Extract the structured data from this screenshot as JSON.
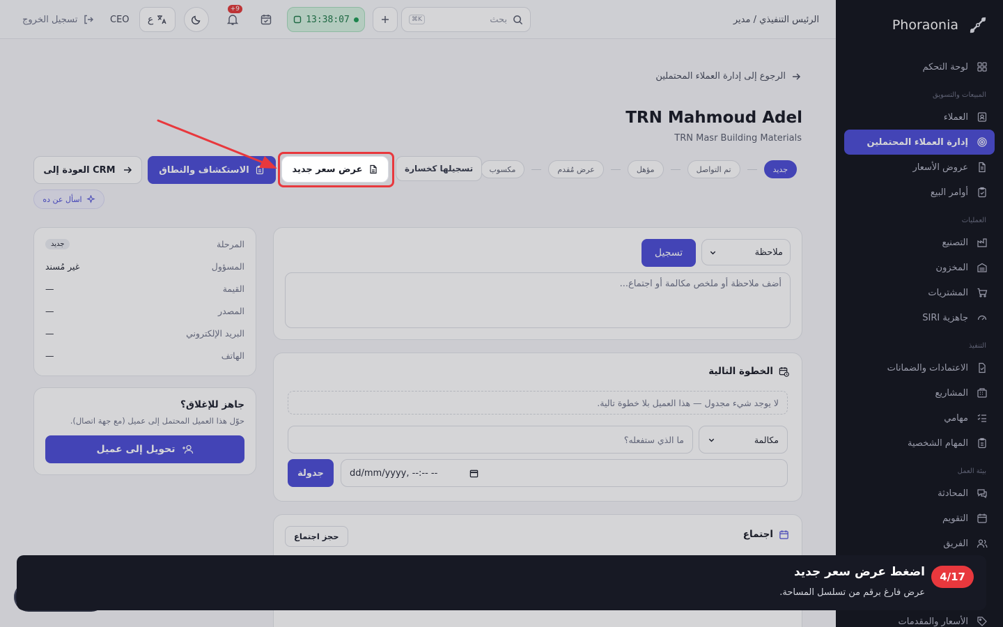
{
  "sidebar": {
    "brand": "Phoraonia",
    "items": [
      {
        "type": "item",
        "label": "لوحة التحكم",
        "icon": "grid-icon"
      },
      {
        "type": "section",
        "label": "المبيعات والتسويق"
      },
      {
        "type": "item",
        "label": "العملاء",
        "icon": "contact-icon"
      },
      {
        "type": "item",
        "label": "إدارة العملاء المحتملين",
        "icon": "target-icon",
        "active": true
      },
      {
        "type": "item",
        "label": "عروض الأسعار",
        "icon": "document-icon"
      },
      {
        "type": "item",
        "label": "أوامر البيع",
        "icon": "clipboard-check-icon"
      },
      {
        "type": "section",
        "label": "العمليات"
      },
      {
        "type": "item",
        "label": "التصنيع",
        "icon": "factory-icon"
      },
      {
        "type": "item",
        "label": "المخزون",
        "icon": "warehouse-icon"
      },
      {
        "type": "item",
        "label": "المشتريات",
        "icon": "cart-icon"
      },
      {
        "type": "item",
        "label": "جاهزية SIRI",
        "icon": "gauge-icon"
      },
      {
        "type": "section",
        "label": "التنفيذ"
      },
      {
        "type": "item",
        "label": "الاعتمادات والضمانات",
        "icon": "file-check-icon"
      },
      {
        "type": "item",
        "label": "المشاريع",
        "icon": "building-icon"
      },
      {
        "type": "item",
        "label": "مهامي",
        "icon": "checklist-icon"
      },
      {
        "type": "item",
        "label": "المهام الشخصية",
        "icon": "clipboard-icon"
      },
      {
        "type": "section",
        "label": "بيئة العمل"
      },
      {
        "type": "item",
        "label": "المحادثة",
        "icon": "chat-icon"
      },
      {
        "type": "item",
        "label": "التقويم",
        "icon": "calendar-icon"
      },
      {
        "type": "item",
        "label": "الفريق",
        "icon": "team-icon"
      }
    ],
    "bottom_item": "الأسعار والمقدمات"
  },
  "topbar": {
    "role": "الرئيس التنفيذي / مدير",
    "search_placeholder": "بحث",
    "search_kbd": "K⌘",
    "clock": "13:38:07",
    "notifications": "+9",
    "lang_label": "ع",
    "user": "CEO",
    "logout": "تسجيل الخروج"
  },
  "lead": {
    "back": "الرجوع إلى إدارة العملاء المحتملين",
    "name": "TRN Mahmoud Adel",
    "company": "TRN Masr Building Materials",
    "stages": [
      "جديد",
      "تم التواصل",
      "مؤهل",
      "عرض مُقدم",
      "مكسوب"
    ],
    "current_stage": "جديد",
    "mark_lost": "تسجيلها كخسارة",
    "new_quote": "عرض سعر جديد",
    "discovery": "الاستكشاف والنطاق",
    "back_crm": "العودة إلى CRM",
    "ask": "اسأل عن ده"
  },
  "info": {
    "rows": [
      {
        "k": "المرحلة",
        "v": "جديد"
      },
      {
        "k": "المسؤول",
        "v": "غير مُسند"
      },
      {
        "k": "القيمة",
        "v": "—"
      },
      {
        "k": "المصدر",
        "v": "—"
      },
      {
        "k": "البريد الإلكتروني",
        "v": "—"
      },
      {
        "k": "الهاتف",
        "v": "—"
      }
    ]
  },
  "close": {
    "title": "جاهز للإغلاق؟",
    "desc": "حوّل هذا العميل المحتمل إلى عميل (مع جهة اتصال).",
    "button": "تحويل إلى عميل"
  },
  "note": {
    "type": "ملاحظة",
    "submit": "تسجيل",
    "placeholder": "أضف ملاحظة أو ملخص مكالمة أو اجتماع..."
  },
  "next_step": {
    "title": "الخطوة التالية",
    "empty": "لا يوجد شيء مجدول — هذا العميل بلا خطوة تالية.",
    "type": "مكالمة",
    "what_placeholder": "ما الذي ستفعله؟",
    "date_placeholder": "dd/mm/yyyy, --:-- --",
    "schedule": "جدولة"
  },
  "meeting": {
    "title": "اجتماع",
    "book": "حجز اجتماع"
  },
  "tour": {
    "step": "4/17",
    "title": "اضغط عرض سعر جديد",
    "desc": "عرض فارغ برقم من تسلسل المساحة."
  },
  "colors": {
    "accent": "#4e4fd7",
    "sidebar": "#14161f",
    "highlight": "#e8383d",
    "clock_bg": "#d7f3e2"
  }
}
